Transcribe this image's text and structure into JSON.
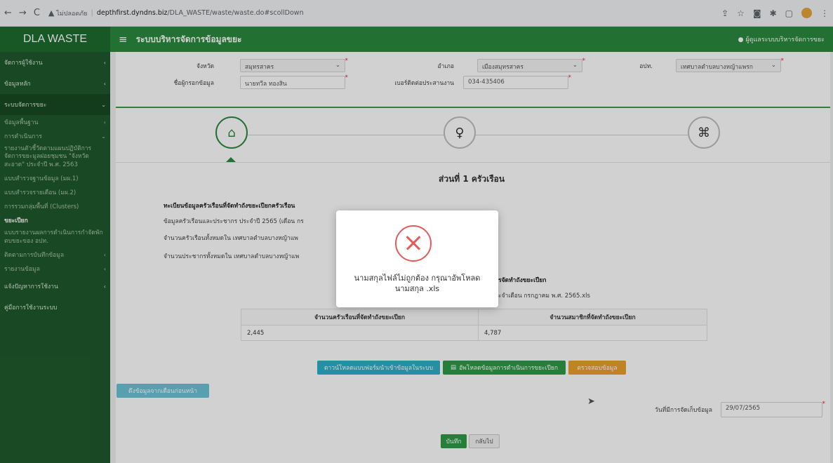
{
  "browser": {
    "nav_back": "←",
    "nav_forward": "→",
    "reload": "C",
    "security_label": "ไม่ปลอดภัย",
    "url_host": "depthfirst.dyndns.biz",
    "url_path": "/DLA_WASTE/waste/waste.do#scollDown"
  },
  "header": {
    "brand": "DLA WASTE",
    "menu_icon": "≡",
    "system_title": "ระบบบริหารจัดการข้อมูลขยะ",
    "user_label": "ผู้ดูแลระบบบริหารจัดการขยะ"
  },
  "sidebar": {
    "items": [
      {
        "label": "จัดการผู้ใช้งาน",
        "kind": "main",
        "chev": "‹"
      },
      {
        "label": "ข้อมูลหลัก",
        "kind": "main",
        "chev": "‹"
      },
      {
        "label": "ระบบจัดการขยะ",
        "kind": "main",
        "chev": "⌄"
      },
      {
        "label": "ข้อมูลพื้นฐาน",
        "kind": "sub",
        "chev": "‹"
      },
      {
        "label": "การดำเนินการ",
        "kind": "sub",
        "chev": "⌄"
      },
      {
        "label": "รายงานตัวชี้วัดตามแผนปฏิบัติการจัดการขยะมูลฝอยชุมชน \"จังหวัดสะอาด\" ประจำปี พ.ศ. 2563",
        "kind": "multi"
      },
      {
        "label": "แบบสำรวจฐานข้อมูล (มผ.1)",
        "kind": "sub"
      },
      {
        "label": "แบบสำรวจรายเดือน (มผ.2)",
        "kind": "sub"
      },
      {
        "label": "การรวมกลุ่มพื้นที่ (Clusters)",
        "kind": "sub"
      },
      {
        "label": "ขยะเปียก",
        "kind": "active"
      },
      {
        "label": "แบบรายงานผลการดำเนินการกำจัดพักตบขยะของ อปท.",
        "kind": "multi"
      },
      {
        "label": "ติดตามการบันทึกข้อมูล",
        "kind": "sub",
        "chev": "‹"
      },
      {
        "label": "รายงานข้อมูล",
        "kind": "sub",
        "chev": "‹"
      },
      {
        "label": "แจ้งปัญหาการใช้งาน",
        "kind": "main",
        "chev": "‹"
      },
      {
        "label": "คู่มือการใช้งานระบบ",
        "kind": "main"
      }
    ]
  },
  "form": {
    "province_label": "จังหวัด",
    "province_value": "สมุทรสาคร",
    "district_label": "อำเภอ",
    "district_value": "เมืองสมุทรสาคร",
    "lao_label": "อปท.",
    "lao_value": "เทศบาลตำบลบางหญ้าแพรก",
    "reporter_label": "ชื่อผู้กรอกข้อมูล",
    "reporter_value": "นายทวีล ทองสิน",
    "phone_label": "เบอร์ติดต่อประสานงาน",
    "phone_value": "034-435406"
  },
  "steps": {
    "icon1": "⌂",
    "icon2": "♀",
    "icon3": "⌘"
  },
  "section": {
    "title": "ส่วนที่ 1 ครัวเรือน",
    "subtitle": "ทะเบียนข้อมูลครัวเรือนที่จัดทำถังขยะเปียกครัวเรือน",
    "line1": "ข้อมูลครัวเรือนและประชากร ประจำปี 2565 (เดือน กร",
    "line2": "จำนวนครัวเรือนทั้งหมดใน เทศบาลตำบลบางหญ้าแพ",
    "line3": "จำนวนประชากรทั้งหมดใน เทศบาลตำบลบางหญ้าแพ",
    "upload_heading": "รจัดทำถังขยะเปียก",
    "upload_file": "ะจำเดือน กรกฎาคม พ.ศ. 2565.xls"
  },
  "table": {
    "col1": "จำนวนครัวเรือนที่จัดทำถังขยะเปียก",
    "col2": "จำนวนสมาชิกที่จัดทำถังขยะเปียก",
    "val1": "2,445",
    "val2": "4,787"
  },
  "buttons": {
    "download_template": "ดาวน์โหลดแบบฟอร์มนำเข้าข้อมูลในระบบ",
    "upload": "อัพโหลดข้อมูลการดำเนินการขยะเปียก",
    "verify": "ตรวจสอบข้อมูล",
    "prev_month": "ดึงข้อมูลจากเดือนก่อนหน้า",
    "save": "บันทึก",
    "back": "กลับไป"
  },
  "record_date": {
    "label": "วันที่มีการจัดเก็บข้อมูล",
    "value": "29/07/2565"
  },
  "modal": {
    "line1": "นามสกุลไฟล์ไม่ถูกต้อง กรุณาอัพโหลด",
    "line2": "นามสกุล .xls"
  }
}
